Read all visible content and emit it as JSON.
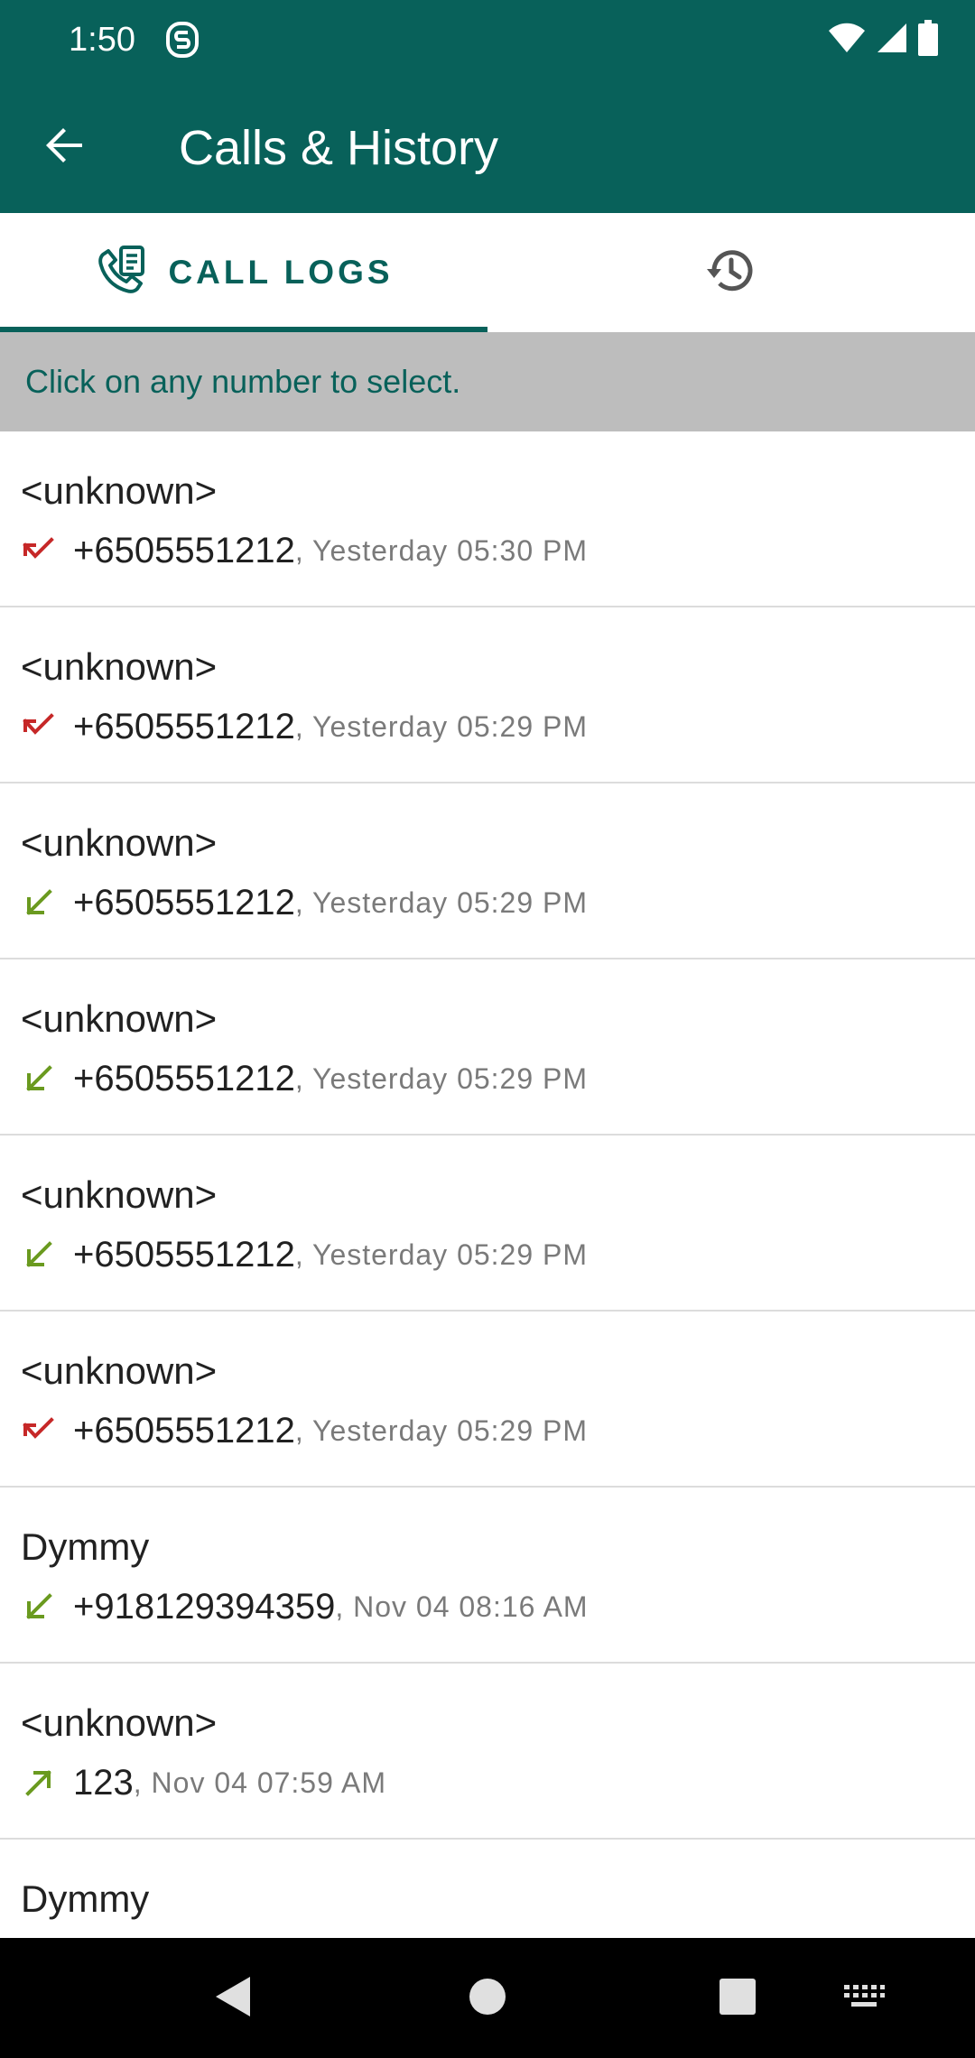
{
  "status_bar": {
    "time": "1:50",
    "icons": [
      "app-status-icon",
      "wifi-icon",
      "signal-icon",
      "battery-icon"
    ]
  },
  "app_bar": {
    "title": "Calls & History",
    "back_icon": "arrow-back-icon"
  },
  "tabs": [
    {
      "label": "CALL LOGS",
      "icon": "call-log-icon",
      "selected": true
    },
    {
      "label": "",
      "icon": "history-icon",
      "selected": false
    }
  ],
  "banner": {
    "text": "Click on any number to select."
  },
  "calls": [
    {
      "name": "<unknown>",
      "number": "+6505551212",
      "time": ", Yesterday 05:30 PM",
      "type": "missed"
    },
    {
      "name": "<unknown>",
      "number": "+6505551212",
      "time": ", Yesterday 05:29 PM",
      "type": "missed"
    },
    {
      "name": "<unknown>",
      "number": "+6505551212",
      "time": ", Yesterday 05:29 PM",
      "type": "incoming"
    },
    {
      "name": "<unknown>",
      "number": "+6505551212",
      "time": ", Yesterday 05:29 PM",
      "type": "incoming"
    },
    {
      "name": "<unknown>",
      "number": "+6505551212",
      "time": ", Yesterday 05:29 PM",
      "type": "incoming"
    },
    {
      "name": "<unknown>",
      "number": "+6505551212",
      "time": ", Yesterday 05:29 PM",
      "type": "missed"
    },
    {
      "name": "Dymmy",
      "number": "+918129394359",
      "time": ", Nov 04 08:16 AM",
      "type": "incoming"
    },
    {
      "name": "<unknown>",
      "number": "123",
      "time": ", Nov 04 07:59 AM",
      "type": "outgoing"
    },
    {
      "name": "Dymmy",
      "number": "",
      "time": "",
      "type": ""
    }
  ],
  "colors": {
    "primary": "#08615a",
    "missed": "#c62828",
    "incoming": "#6a9a1f",
    "outgoing": "#6a9a1f",
    "banner_bg": "#bdbdbd"
  },
  "nav_bar": {
    "icons": [
      "nav-back-icon",
      "nav-home-icon",
      "nav-recents-icon",
      "keyboard-icon"
    ]
  }
}
